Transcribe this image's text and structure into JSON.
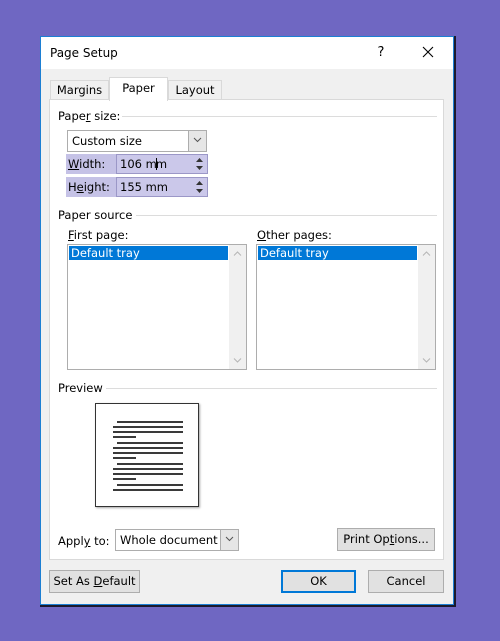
{
  "dialog": {
    "title": "Page Setup",
    "help_label": "?",
    "close_icon": "close-icon"
  },
  "tabs": [
    {
      "label": "Margins",
      "active": false
    },
    {
      "label": "Paper",
      "active": true
    },
    {
      "label": "Layout",
      "active": false
    }
  ],
  "paper_size": {
    "group_label_pre": "Pape",
    "group_label_u": "r",
    "group_label_post": " size:",
    "selected": "Custom size",
    "width": {
      "label_u": "W",
      "label_rest": "idth:",
      "value_pre": "106 m",
      "value_post": "m"
    },
    "height": {
      "label_pre": "H",
      "label_u": "e",
      "label_rest": "ight:",
      "value": "155 mm"
    }
  },
  "paper_source": {
    "group_label": "Paper source",
    "first_page": {
      "label_u": "F",
      "label_rest": "irst page:",
      "items": [
        "Default tray"
      ],
      "selected": "Default tray"
    },
    "other_pages": {
      "label_u": "O",
      "label_rest": "ther pages:",
      "items": [
        "Default tray"
      ],
      "selected": "Default tray"
    }
  },
  "preview": {
    "group_label": "Preview"
  },
  "apply_to": {
    "label_pre": "Appl",
    "label_u": "y",
    "label_post": " to:",
    "selected": "Whole document"
  },
  "buttons": {
    "print_options": {
      "pre": "Print Op",
      "u": "t",
      "post": "ions..."
    },
    "set_as_default": {
      "pre": "Set As ",
      "u": "D",
      "post": "efault"
    },
    "ok": "OK",
    "cancel": "Cancel"
  },
  "colors": {
    "background": "#6f67c2",
    "selection": "#0078d7",
    "highlight": "#c5c2e6"
  }
}
